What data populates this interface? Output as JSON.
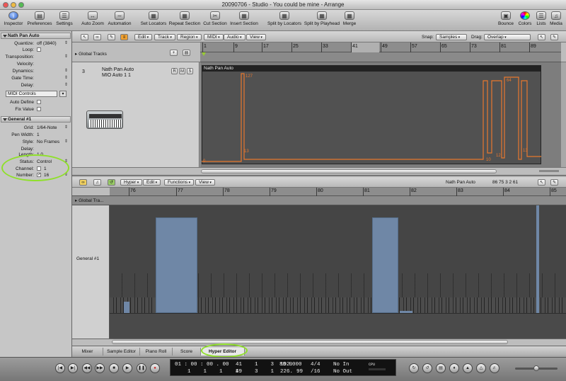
{
  "window": {
    "title": "20090706 - Studio - You could be mine - Arrange"
  },
  "toolbar": {
    "left": [
      {
        "label": "Inspector",
        "icon": "info-icon"
      },
      {
        "label": "Preferences",
        "icon": "switch-icon"
      },
      {
        "label": "Settings",
        "icon": "settings-icon"
      },
      {
        "label": "Auto Zoom",
        "icon": "zoom-icon"
      },
      {
        "label": "Automation",
        "icon": "automation-icon"
      },
      {
        "label": "Set Locators",
        "icon": "locators-icon"
      },
      {
        "label": "Repeat Section",
        "icon": "repeat-icon"
      },
      {
        "label": "Cut Section",
        "icon": "cut-icon"
      },
      {
        "label": "Insert Section",
        "icon": "insert-icon"
      },
      {
        "label": "Split by Locators",
        "icon": "split-locators-icon"
      },
      {
        "label": "Split by Playhead",
        "icon": "split-playhead-icon"
      },
      {
        "label": "Merge",
        "icon": "merge-icon"
      }
    ],
    "right": [
      {
        "label": "Bounce",
        "icon": "bounce-icon"
      },
      {
        "label": "Colors",
        "icon": "colors-icon"
      },
      {
        "label": "Lists",
        "icon": "lists-icon"
      },
      {
        "label": "Media",
        "icon": "media-icon"
      }
    ]
  },
  "inspector": {
    "region_header": "Nath Pan Auto",
    "region_params": [
      {
        "label": "Quantize:",
        "value": "off (3840)"
      },
      {
        "label": "Loop:",
        "value": ""
      },
      {
        "label": "Transposition:",
        "value": ""
      },
      {
        "label": "Velocity:",
        "value": ""
      },
      {
        "label": "Dynamics:",
        "value": ""
      },
      {
        "label": "Gate Time:",
        "value": ""
      },
      {
        "label": "Delay:",
        "value": ""
      }
    ],
    "midi_controls_label": "MIDI Controls",
    "auto_define": "Auto Define",
    "fix_value": "Fix Value",
    "group_header": "General #1",
    "group_params": [
      {
        "label": "Grid:",
        "value": "1/64-Note"
      },
      {
        "label": "Pen Width:",
        "value": "1"
      },
      {
        "label": "Style:",
        "value": "No Frames"
      },
      {
        "label": "Delay:",
        "value": ""
      },
      {
        "label": "Length:",
        "value": "1    0"
      },
      {
        "label": "Status:",
        "value": "Control"
      },
      {
        "label": "Channel:",
        "value": "1"
      },
      {
        "label": "Number:",
        "value": "16"
      }
    ]
  },
  "arrange": {
    "menus": [
      "Edit",
      "Track",
      "Region",
      "MIDI",
      "Audio",
      "View"
    ],
    "snap_label": "Snap:",
    "snap_value": "Samples",
    "drag_label": "Drag:",
    "drag_value": "Overlap",
    "global_tracks": "Global Tracks",
    "ruler_numbers": [
      "1",
      "9",
      "17",
      "25",
      "33",
      "41",
      "49",
      "57",
      "65",
      "73",
      "81",
      "89"
    ],
    "track": {
      "number": "3",
      "name": "Nath Pan Auto",
      "device": "MIO Auto 1   1",
      "buttons": [
        "R",
        "M",
        "S"
      ]
    },
    "region_name": "Nath Pan Auto",
    "automation_values": [
      "127",
      "64",
      "13",
      "10",
      "12",
      "13",
      "0"
    ]
  },
  "hyper_editor": {
    "menus": [
      "Hyper",
      "Edit",
      "Functions",
      "View"
    ],
    "region_name": "Nath Pan Auto",
    "position": "86  75 3 2 61",
    "global_tracks": "Global Tra...",
    "ruler_numbers": [
      "76",
      "77",
      "78",
      "79",
      "80",
      "81",
      "82",
      "83",
      "84",
      "85"
    ],
    "lane_name": "General #1",
    "tabs": [
      "Mixer",
      "Sample Editor",
      "Piano Roll",
      "Score",
      "Hyper Editor"
    ],
    "active_tab": "Hyper Editor"
  },
  "transport": {
    "smpte": "01 : 00 : 00 . 00",
    "bars": "1    1    1    1",
    "left_pos_top": "41    1    3  192.",
    "left_pos_bot": "49    3    1  226.",
    "tempo": "80.0000",
    "tempo_bot": "99",
    "signature": "4/4",
    "division": "/16",
    "in": "No In",
    "out": "No Out",
    "cpu": "CPU"
  },
  "colors": {
    "automation": "#e8782e",
    "velocity_bar": "#6f87a6",
    "highlight": "#8fe02a"
  }
}
